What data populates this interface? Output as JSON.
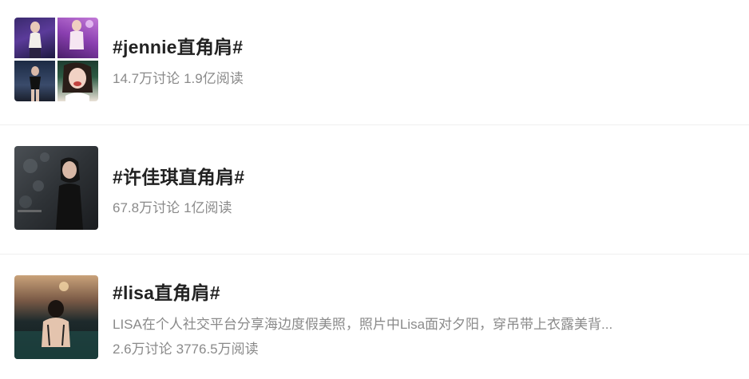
{
  "topics": [
    {
      "title": "#jennie直角肩#",
      "discussions": "14.7万讨论",
      "reads": "1.9亿阅读"
    },
    {
      "title": "#许佳琪直角肩#",
      "discussions": "67.8万讨论",
      "reads": "1亿阅读"
    },
    {
      "title": "#lisa直角肩#",
      "summary": "LISA在个人社交平台分享海边度假美照，照片中Lisa面对夕阳，穿吊带上衣露美背...",
      "discussions": "2.6万讨论",
      "reads": "3776.5万阅读"
    }
  ],
  "colors": {
    "title": "#222222",
    "meta": "#8a8a8a",
    "divider": "#efefef"
  },
  "icons": {
    "row1_thumb": "photo-collage-thumbnail",
    "row2_thumb": "photo-thumbnail",
    "row3_thumb": "photo-thumbnail"
  }
}
